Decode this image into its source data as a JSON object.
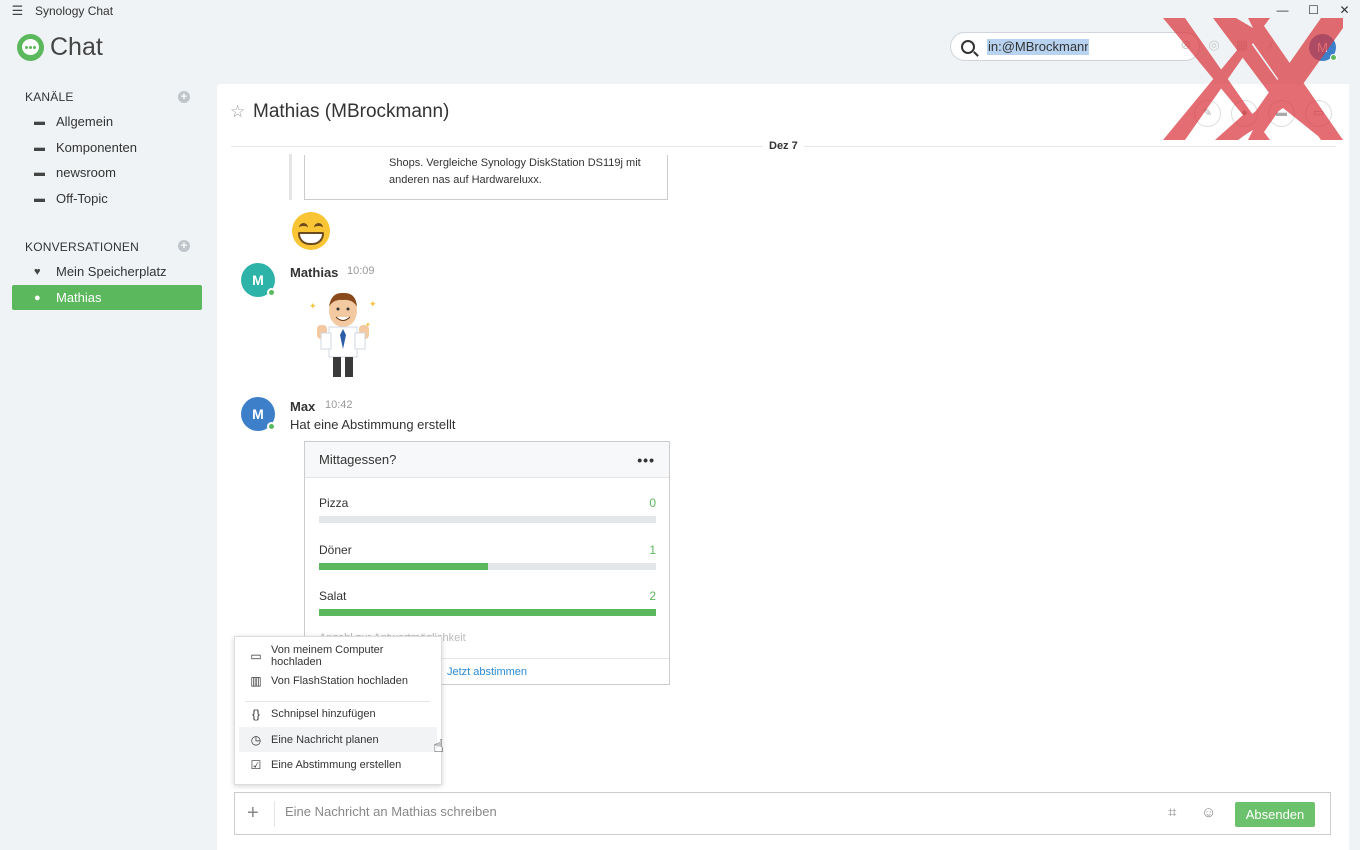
{
  "app": {
    "window_title": "Synology Chat",
    "logo_text": "Chat"
  },
  "search": {
    "value": "in:@MBrockmann"
  },
  "header_avatar": {
    "initial": "M"
  },
  "sidebar": {
    "channels_heading": "KANÄLE",
    "channels": [
      {
        "label": "Allgemein"
      },
      {
        "label": "Komponenten"
      },
      {
        "label": "newsroom"
      },
      {
        "label": "Off-Topic"
      }
    ],
    "conversations_heading": "KONVERSATIONEN",
    "conversations": [
      {
        "label": "Mein Speicherplatz"
      },
      {
        "label": "Mathias",
        "active": true
      }
    ]
  },
  "conversation": {
    "title": "Mathias (MBrockmann)",
    "date_separator": "Dez 7",
    "link_preview_text": "Shops.  Vergleiche Synology DiskStation DS119j mit anderen nas auf Hardwareluxx.",
    "messages": [
      {
        "author": "Mathias",
        "initial": "M",
        "time": "10:09",
        "avatar_color": "#2db3a8"
      },
      {
        "author": "Max",
        "initial": "M",
        "time": "10:42",
        "avatar_color": "#3d7fc9",
        "text": "Hat eine Abstimmung erstellt"
      }
    ],
    "poll": {
      "title": "Mittagessen?",
      "options": [
        {
          "label": "Pizza",
          "count": "0",
          "fraction": 0.0
        },
        {
          "label": "Döner",
          "count": "1",
          "fraction": 0.5
        },
        {
          "label": "Salat",
          "count": "2",
          "fraction": 1.0
        }
      ],
      "faded_text": "Anzahl zur Antwortmöglichkeit",
      "vote_label": "Jetzt abstimmen"
    }
  },
  "attach_menu": {
    "items": [
      {
        "label": "Von meinem Computer hochladen",
        "icon": "monitor-icon"
      },
      {
        "label": "Von FlashStation hochladen",
        "icon": "flashstation-icon"
      },
      {
        "label": "Schnipsel hinzufügen",
        "icon": "code-icon"
      },
      {
        "label": "Eine Nachricht planen",
        "icon": "schedule-icon"
      },
      {
        "label": "Eine Abstimmung erstellen",
        "icon": "poll-icon"
      }
    ]
  },
  "composer": {
    "placeholder": "Eine Nachricht an Mathias schreiben",
    "send_label": "Absenden"
  },
  "colors": {
    "accent_green": "#5cb85c",
    "link_blue": "#2a8ad4",
    "overlay_red": "#d9363e"
  }
}
